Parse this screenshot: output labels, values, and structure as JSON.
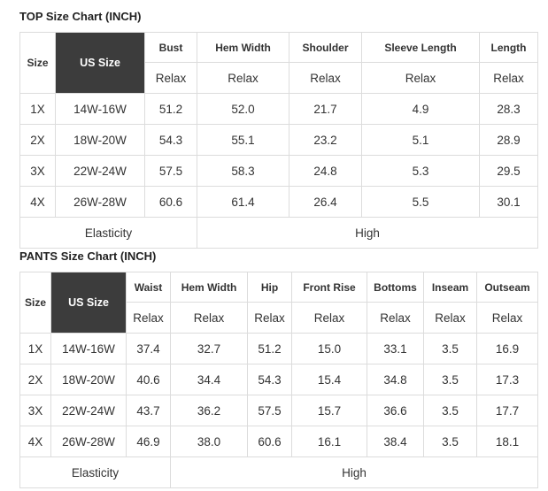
{
  "top": {
    "title": "TOP Size Chart (INCH)",
    "size_label": "Size",
    "us_label": "US Size",
    "columns": [
      "Bust",
      "Hem Width",
      "Shoulder",
      "Sleeve Length",
      "Length"
    ],
    "relax": [
      "Relax",
      "Relax",
      "Relax",
      "Relax",
      "Relax"
    ],
    "rows": [
      {
        "size": "1X",
        "us": "14W-16W",
        "values": [
          "51.2",
          "52.0",
          "21.7",
          "4.9",
          "28.3"
        ]
      },
      {
        "size": "2X",
        "us": "18W-20W",
        "values": [
          "54.3",
          "55.1",
          "23.2",
          "5.1",
          "28.9"
        ]
      },
      {
        "size": "3X",
        "us": "22W-24W",
        "values": [
          "57.5",
          "58.3",
          "24.8",
          "5.3",
          "29.5"
        ]
      },
      {
        "size": "4X",
        "us": "26W-28W",
        "values": [
          "60.6",
          "61.4",
          "26.4",
          "5.5",
          "30.1"
        ]
      }
    ],
    "elasticity_label": "Elasticity",
    "elasticity_value": "High"
  },
  "pants": {
    "title": "PANTS Size Chart (INCH)",
    "size_label": "Size",
    "us_label": "US Size",
    "columns": [
      "Waist",
      "Hem Width",
      "Hip",
      "Front Rise",
      "Bottoms",
      "Inseam",
      "Outseam"
    ],
    "relax": [
      "Relax",
      "Relax",
      "Relax",
      "Relax",
      "Relax",
      "Relax",
      "Relax"
    ],
    "rows": [
      {
        "size": "1X",
        "us": "14W-16W",
        "values": [
          "37.4",
          "32.7",
          "51.2",
          "15.0",
          "33.1",
          "3.5",
          "16.9"
        ]
      },
      {
        "size": "2X",
        "us": "18W-20W",
        "values": [
          "40.6",
          "34.4",
          "54.3",
          "15.4",
          "34.8",
          "3.5",
          "17.3"
        ]
      },
      {
        "size": "3X",
        "us": "22W-24W",
        "values": [
          "43.7",
          "36.2",
          "57.5",
          "15.7",
          "36.6",
          "3.5",
          "17.7"
        ]
      },
      {
        "size": "4X",
        "us": "26W-28W",
        "values": [
          "46.9",
          "38.0",
          "60.6",
          "16.1",
          "38.4",
          "3.5",
          "18.1"
        ]
      }
    ],
    "elasticity_label": "Elasticity",
    "elasticity_value": "High"
  }
}
